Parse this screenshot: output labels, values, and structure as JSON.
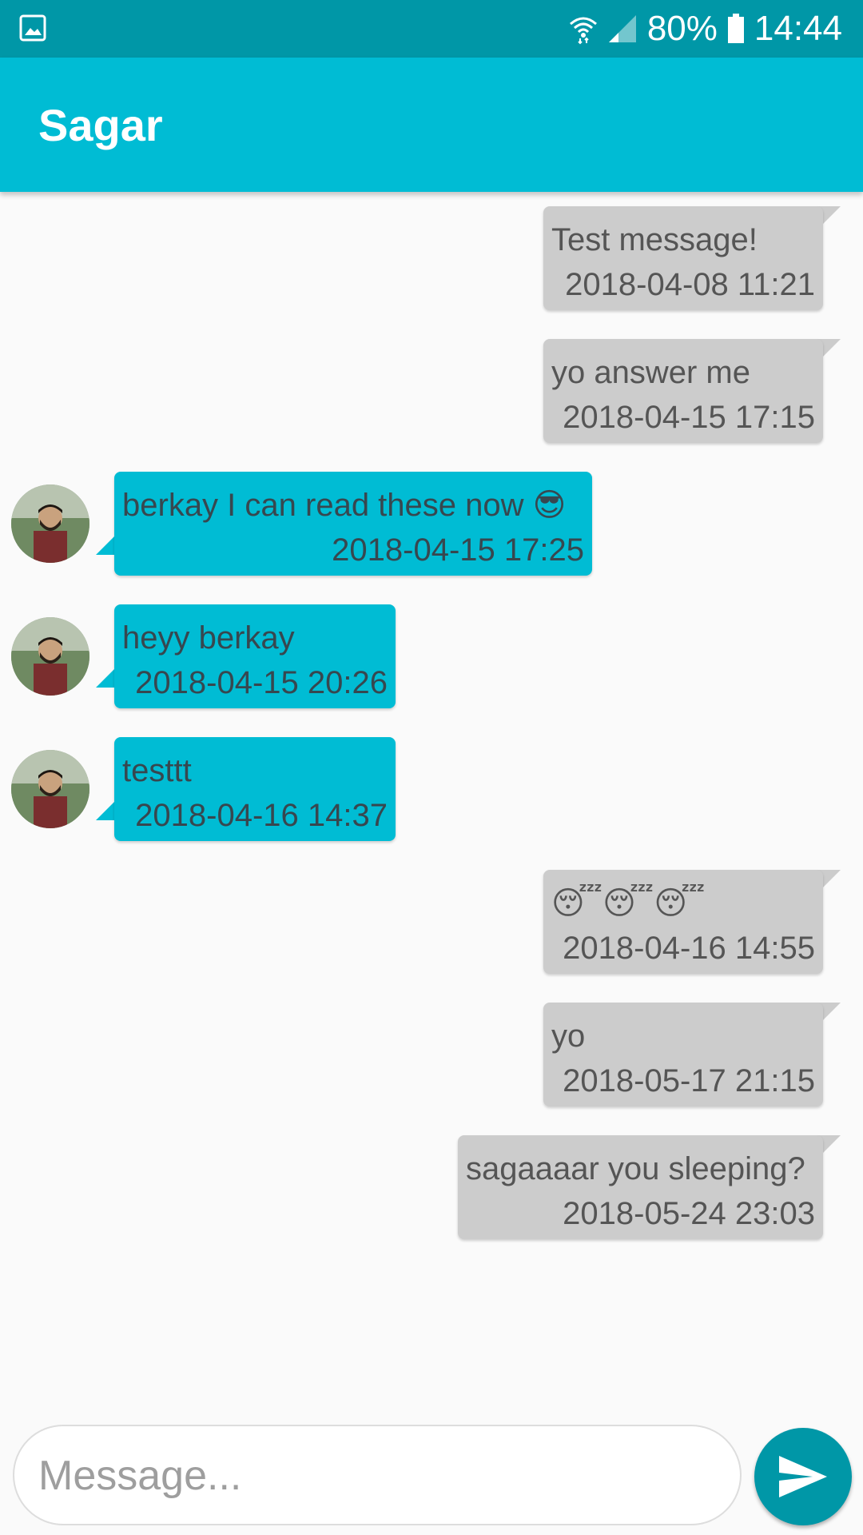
{
  "status_bar": {
    "battery": "80%",
    "time": "14:44",
    "icons": [
      "gallery-notification-icon",
      "wifi-icon",
      "signal-icon",
      "battery-icon"
    ]
  },
  "app_bar": {
    "title": "Sagar"
  },
  "messages": [
    {
      "direction": "outgoing",
      "text": "Test message!",
      "time": "2018-04-08 11:21"
    },
    {
      "direction": "outgoing",
      "text": "yo answer me",
      "time": "2018-04-15 17:15"
    },
    {
      "direction": "incoming",
      "text": "berkay I can read these now 😎",
      "time": "2018-04-15 17:25"
    },
    {
      "direction": "incoming",
      "text": "heyy berkay",
      "time": "2018-04-15 20:26"
    },
    {
      "direction": "incoming",
      "text": "testtt",
      "time": "2018-04-16 14:37"
    },
    {
      "direction": "outgoing",
      "text": "😴😴😴",
      "time": "2018-04-16 14:55"
    },
    {
      "direction": "outgoing",
      "text": "yo",
      "time": "2018-05-17 21:15"
    },
    {
      "direction": "outgoing",
      "text": "sagaaaar you sleeping?",
      "time": "2018-05-24 23:03"
    }
  ],
  "composer": {
    "value": "",
    "placeholder": "Message...",
    "send_icon": "send-icon"
  },
  "colors": {
    "status_bar": "#0097a7",
    "app_bar": "#00bcd4",
    "incoming_bubble": "#00bcd4",
    "outgoing_bubble": "#cccccc",
    "send_button": "#0097a7"
  }
}
